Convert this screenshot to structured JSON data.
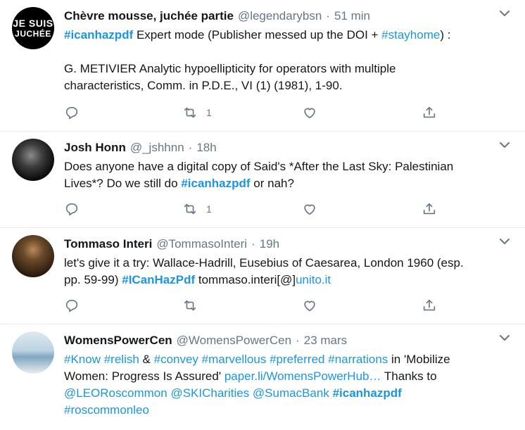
{
  "tweets": [
    {
      "avatar_text": [
        "JE SUIS",
        "JUCHÉE"
      ],
      "name": "Chèvre mousse, juchée partie",
      "handle": "@legendarybsn",
      "sep": "·",
      "time": "51 min",
      "lines": [
        [
          {
            "t": "tag",
            "v": "#icanhazpdf"
          },
          {
            "t": "text",
            "v": " Expert mode (Publisher messed up the DOI + "
          },
          {
            "t": "link",
            "v": "#stayhome"
          },
          {
            "t": "text",
            "v": ") :"
          }
        ],
        [],
        [
          {
            "t": "text",
            "v": "G. METIVIER Analytic hypoellipticity for operators with multiple"
          }
        ],
        [
          {
            "t": "text",
            "v": "characteristics, Comm. in P.D.E., VI (1) (1981), 1-90."
          }
        ]
      ],
      "retweets": "1",
      "likes": ""
    },
    {
      "name": "Josh Honn",
      "handle": "@_jshhnn",
      "sep": "·",
      "time": "18h",
      "lines": [
        [
          {
            "t": "text",
            "v": "Does anyone have a digital copy of Said's *After the Last Sky: Palestinian"
          }
        ],
        [
          {
            "t": "text",
            "v": "Lives*? Do we still do "
          },
          {
            "t": "tag",
            "v": "#icanhazpdf"
          },
          {
            "t": "text",
            "v": " or nah?"
          }
        ]
      ],
      "retweets": "1",
      "likes": ""
    },
    {
      "name": "Tommaso Interi",
      "handle": "@TommasoInteri",
      "sep": "·",
      "time": "19h",
      "lines": [
        [
          {
            "t": "text",
            "v": "let's give it a try: Wallace-Hadrill, Eusebius of Caesarea, London 1960 (esp."
          }
        ],
        [
          {
            "t": "text",
            "v": "pp. 59-99) "
          },
          {
            "t": "tag",
            "v": "#ICanHazPdf"
          },
          {
            "t": "text",
            "v": " tommaso.interi[@]"
          },
          {
            "t": "link",
            "v": "unito.it"
          }
        ]
      ],
      "retweets": "",
      "likes": ""
    },
    {
      "name": "WomensPowerCen",
      "handle": "@WomensPowerCen",
      "sep": "·",
      "time": "23 mars",
      "lines": [
        [
          {
            "t": "link",
            "v": "#Know"
          },
          {
            "t": "text",
            "v": " "
          },
          {
            "t": "link",
            "v": "#relish"
          },
          {
            "t": "text",
            "v": " & "
          },
          {
            "t": "link",
            "v": "#convey"
          },
          {
            "t": "text",
            "v": " "
          },
          {
            "t": "link",
            "v": "#marvellous"
          },
          {
            "t": "text",
            "v": " "
          },
          {
            "t": "link",
            "v": "#preferred"
          },
          {
            "t": "text",
            "v": " "
          },
          {
            "t": "link",
            "v": "#narrations"
          },
          {
            "t": "text",
            "v": " in 'Mobilize"
          }
        ],
        [
          {
            "t": "text",
            "v": "Women: Progress Is Assured' "
          },
          {
            "t": "link",
            "v": "paper.li/WomensPowerHub…"
          },
          {
            "t": "text",
            "v": " Thanks to"
          }
        ],
        [
          {
            "t": "link",
            "v": "@LEORoscommon"
          },
          {
            "t": "text",
            "v": " "
          },
          {
            "t": "link",
            "v": "@SKICharities"
          },
          {
            "t": "text",
            "v": " "
          },
          {
            "t": "link",
            "v": "@SumacBank"
          },
          {
            "t": "text",
            "v": " "
          },
          {
            "t": "tag",
            "v": "#icanhazpdf"
          }
        ],
        [
          {
            "t": "link",
            "v": "#roscommonleo"
          }
        ]
      ]
    }
  ],
  "colors": {
    "link": "#1b95e0",
    "secondary": "#657786",
    "border": "#e6ecf0"
  }
}
